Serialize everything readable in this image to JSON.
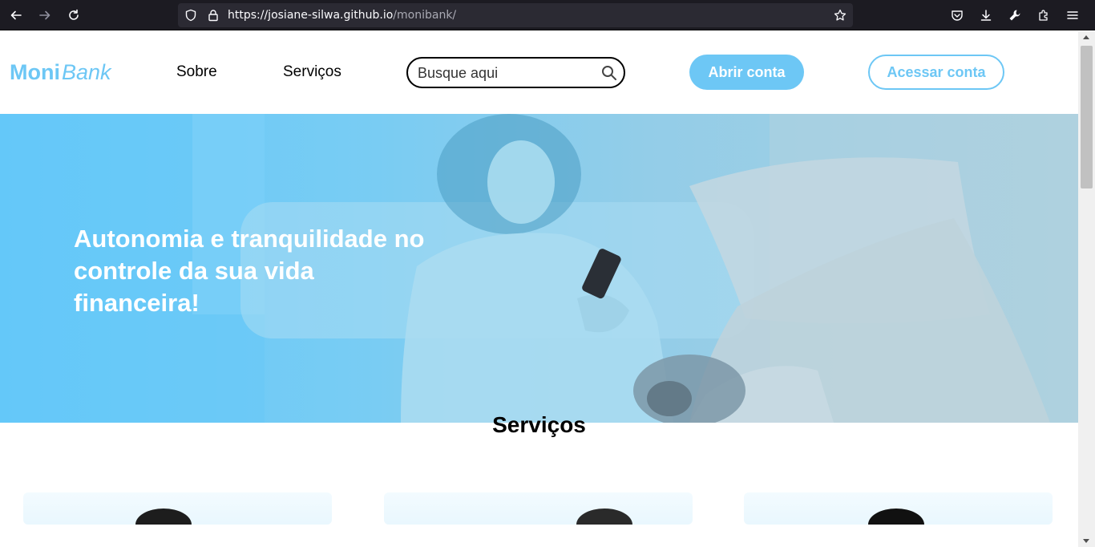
{
  "browser": {
    "url_host": "https://josiane-silwa.github.io",
    "url_path": "/monibank/",
    "icons": [
      "back-arrow-icon",
      "forward-arrow-icon",
      "reload-icon",
      "shield-icon",
      "lock-icon",
      "star-icon",
      "pocket-icon",
      "download-icon",
      "wrench-icon",
      "extensions-icon",
      "menu-icon"
    ]
  },
  "site": {
    "logo_bold": "Moni",
    "logo_italic": "Bank",
    "nav": [
      "Sobre",
      "Serviços"
    ],
    "search_placeholder": "Busque aqui",
    "btn_open_account": "Abrir conta",
    "btn_access_account": "Acessar conta",
    "hero_title": "Autonomia e tranquilidade no controle da sua vida financeira!",
    "services_title": "Serviços"
  },
  "colors": {
    "brand": "#6dc7f5",
    "chrome_bg": "#1c1b22",
    "urlbar_bg": "#2b2a33"
  }
}
